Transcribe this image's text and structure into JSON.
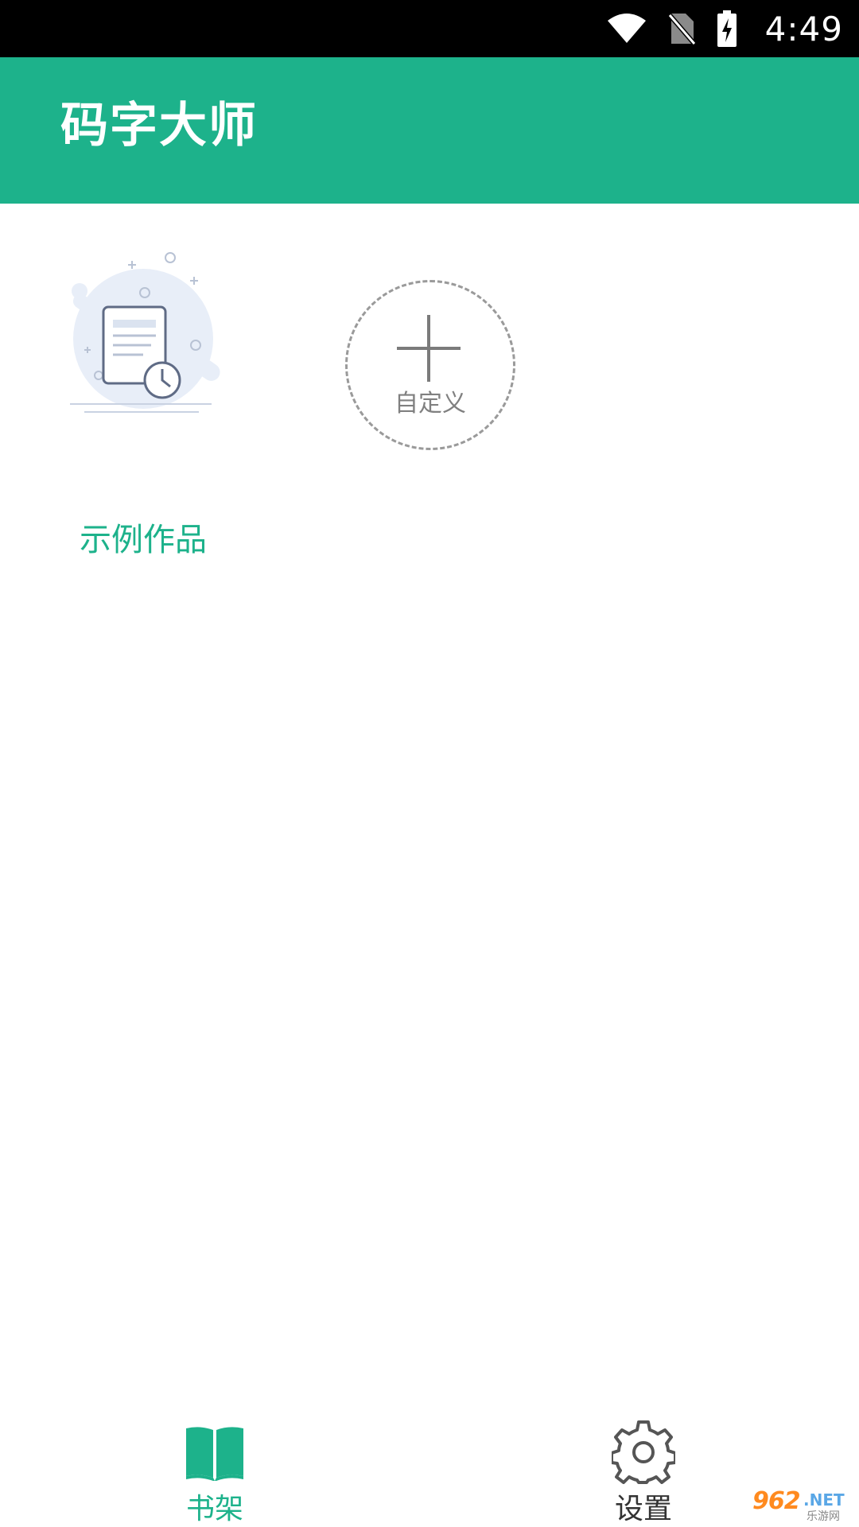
{
  "status_bar": {
    "time": "4:49",
    "icons": [
      "wifi-icon",
      "no-sim-icon",
      "battery-charging-icon"
    ]
  },
  "app_bar": {
    "title": "码字大师"
  },
  "shelf": {
    "books": [
      {
        "title": "示例作品",
        "cover_icon": "document-clock-illustration"
      }
    ],
    "custom": {
      "label": "自定义",
      "icon": "plus-icon"
    }
  },
  "bottom_nav": {
    "items": [
      {
        "label": "书架",
        "icon": "open-book-icon",
        "active": true
      },
      {
        "label": "设置",
        "icon": "gear-icon",
        "active": false
      }
    ]
  },
  "watermark": {
    "main": "962",
    "suffix": ".NET",
    "sub": "乐游网"
  },
  "colors": {
    "primary": "#1db28b",
    "status_bar": "#000000",
    "inactive_text": "#333333",
    "placeholder": "#808080"
  }
}
